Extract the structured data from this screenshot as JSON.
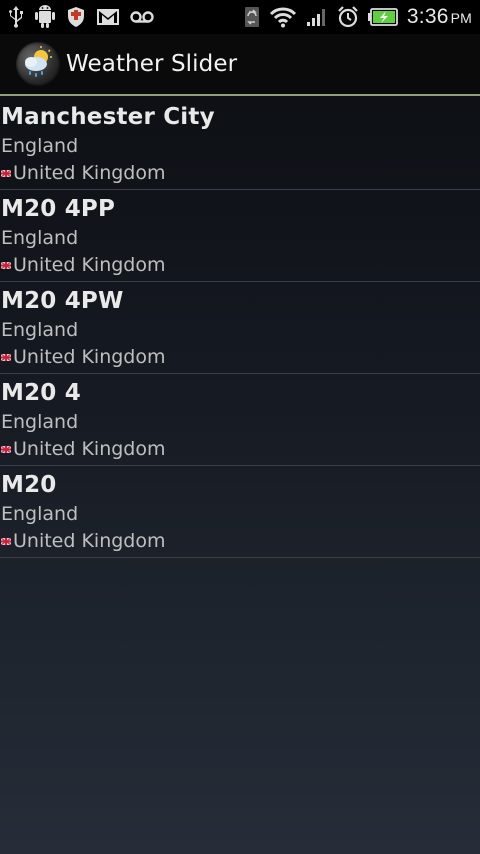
{
  "status_bar": {
    "time": "3:36",
    "ampm": "PM",
    "left_icons": [
      "usb-icon",
      "android-debug-icon",
      "shield-icon",
      "gmail-icon",
      "voicemail-icon"
    ],
    "right_icons": [
      "sync-icon",
      "wifi-icon",
      "signal-icon",
      "alarm-icon",
      "battery-charging-icon"
    ]
  },
  "app": {
    "title": "Weather Slider",
    "icon": "weather-app-icon"
  },
  "colors": {
    "action_bar_divider": "#8ea07f",
    "list_divider": "#3a3f47",
    "battery": "#5fcf3f"
  },
  "locations": [
    {
      "name": "Manchester City",
      "region": "England",
      "country": "United Kingdom",
      "flag": "uk-flag-icon"
    },
    {
      "name": "M20 4PP",
      "region": "England",
      "country": "United Kingdom",
      "flag": "uk-flag-icon"
    },
    {
      "name": "M20 4PW",
      "region": "England",
      "country": "United Kingdom",
      "flag": "uk-flag-icon"
    },
    {
      "name": "M20 4",
      "region": "England",
      "country": "United Kingdom",
      "flag": "uk-flag-icon"
    },
    {
      "name": "M20",
      "region": "England",
      "country": "United Kingdom",
      "flag": "uk-flag-icon"
    }
  ]
}
